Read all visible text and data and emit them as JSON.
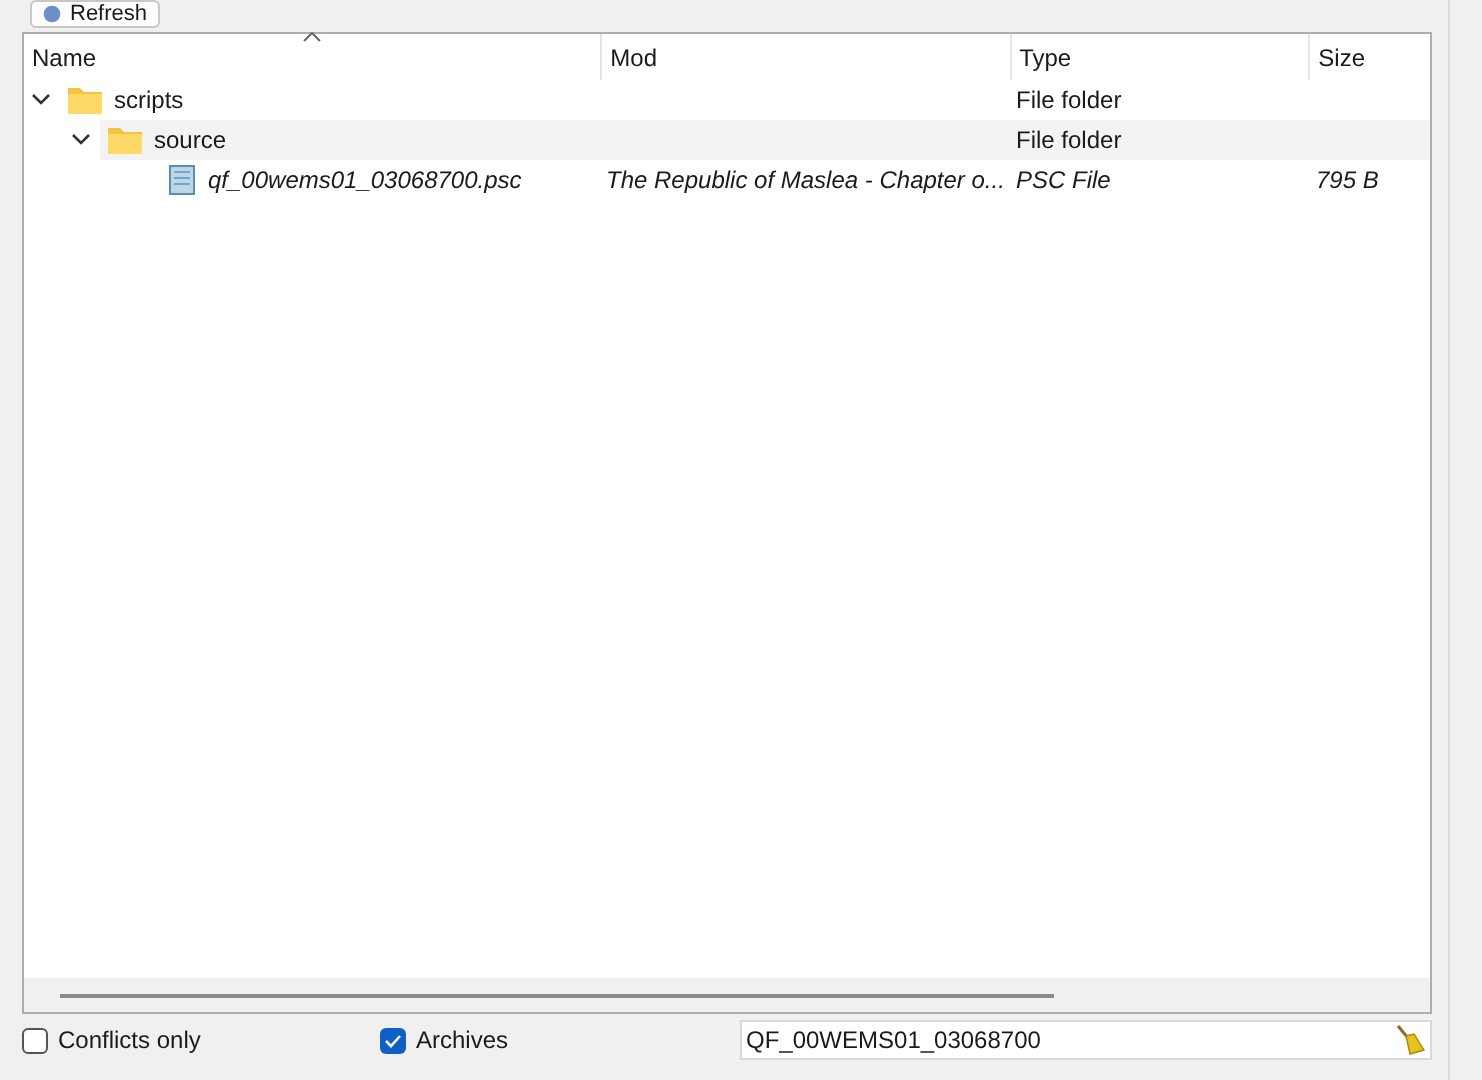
{
  "toolbar": {
    "refresh_button": "Refresh"
  },
  "tree": {
    "columns": [
      {
        "label": "Name",
        "sorted": true
      },
      {
        "label": "Mod",
        "sorted": false
      },
      {
        "label": "Type",
        "sorted": false
      },
      {
        "label": "Size",
        "sorted": false
      }
    ],
    "rows": [
      {
        "kind": "folder",
        "name": "scripts",
        "type": "File folder",
        "expanded": true,
        "selected": false,
        "children": [
          {
            "kind": "folder",
            "name": "source",
            "type": "File folder",
            "expanded": true,
            "selected": true,
            "children": [
              {
                "kind": "file",
                "name": "qf_00wems01_03068700.psc",
                "mod": "The Republic of Maslea - Chapter o...",
                "type": "PSC File",
                "size": "795 B",
                "selected": false
              }
            ]
          }
        ]
      }
    ]
  },
  "filters": {
    "conflicts_only": {
      "label": "Conflicts only",
      "checked": false
    },
    "archives": {
      "label": "Archives",
      "checked": true
    },
    "search": {
      "value": "QF_00WEMS01_03068700"
    }
  }
}
